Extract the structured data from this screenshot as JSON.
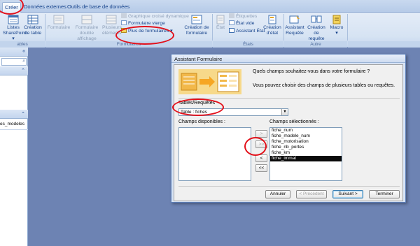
{
  "tabs": [
    {
      "label": "Créer",
      "active": true
    },
    {
      "label": "Données externes",
      "active": false
    },
    {
      "label": "Outils de base de données",
      "active": false
    }
  ],
  "ribbon": {
    "listes_sharepoint": [
      "Listes",
      "SharePoint ▾"
    ],
    "creation_table": [
      "Création",
      "de table"
    ],
    "formulaire": "Formulaire",
    "formulaire_double": [
      "Formulaire",
      "double affichage"
    ],
    "plusieurs_elements": [
      "Plusieurs",
      "éléments"
    ],
    "graphique_croise": "Graphique croisé dynamique",
    "formulaire_vierge": "Formulaire vierge",
    "plus_de_formulaires": "Plus de formulaires ▾",
    "creation_formulaire": [
      "Création de",
      "formulaire"
    ],
    "etat": "État",
    "etiquettes": "Étiquettes",
    "etat_vide": "État vide",
    "assistant_etat": "Assistant État",
    "creation_etat": [
      "Création",
      "d'état"
    ],
    "assistant_requete": [
      "Assistant",
      "Requête"
    ],
    "creation_requete": [
      "Création de",
      "requête"
    ],
    "macro": [
      "Macro",
      "▾"
    ],
    "groups": {
      "tables": "ables",
      "formulaires": "Formulaires",
      "etats": "États",
      "autre": "Autre"
    }
  },
  "nav": {
    "item": "es_modeles"
  },
  "dialog": {
    "title": "Assistant Formulaire",
    "question": "Quels champs souhaitez-vous dans votre formulaire ?",
    "hint": "Vous pouvez choisir des champs de plusieurs tables ou requêtes.",
    "tables_label": "Tables/Requêtes",
    "tables_value": "Table : fiches",
    "available_label": "Champs disponibles :",
    "selected_label": "Champs sélectionnés :",
    "selected_fields": [
      "fiche_num",
      "fiche_modele_num",
      "fiche_motorisation",
      "fiche_nb_portes",
      "fiche_km",
      "fiche_immat"
    ],
    "btn_add": ">",
    "btn_add_all": ">>",
    "btn_remove": "<",
    "btn_remove_all": "<<",
    "btn_cancel": "Annuler",
    "btn_prev": "< Précédent",
    "btn_next": "Suivant >",
    "btn_finish": "Terminer"
  },
  "colors": {
    "annotation": "#e3111b",
    "ribbon": "#d6e3f3",
    "workspace": "#6d83b3"
  }
}
